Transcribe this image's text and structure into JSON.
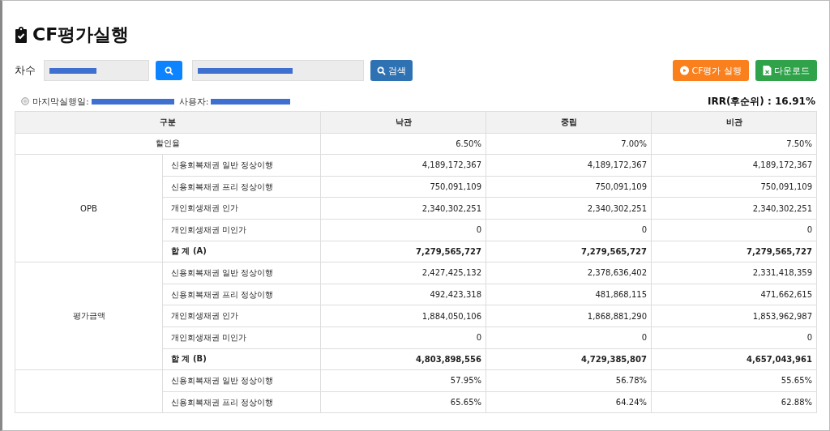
{
  "title": "CF평가실행",
  "filter": {
    "round_label": "차수",
    "search_button": "검색"
  },
  "actions": [
    {
      "kind": "run",
      "label": "CF평가 실행"
    },
    {
      "kind": "download",
      "label": "다운로드"
    }
  ],
  "info": {
    "last_run_label": "마지막실행일:",
    "user_label": "사용자:",
    "irr": "IRR(후순위) : 16.91%"
  },
  "table": {
    "columns": [
      "구분",
      "낙관",
      "중립",
      "비관"
    ],
    "rate_row": {
      "label": "할인율",
      "values": [
        "6.50%",
        "7.00%",
        "7.50%"
      ]
    },
    "groups": [
      {
        "label": "OPB",
        "rows": [
          {
            "kind": "item",
            "label": "신용회복채권 일반 정상이행",
            "values": [
              "4,189,172,367",
              "4,189,172,367",
              "4,189,172,367"
            ]
          },
          {
            "kind": "item",
            "label": "신용회복채권 프리 정상이행",
            "values": [
              "750,091,109",
              "750,091,109",
              "750,091,109"
            ]
          },
          {
            "kind": "item",
            "label": "개인회생채권 인가",
            "values": [
              "2,340,302,251",
              "2,340,302,251",
              "2,340,302,251"
            ]
          },
          {
            "kind": "item",
            "label": "개인회생채권 미인가",
            "values": [
              "0",
              "0",
              "0"
            ]
          },
          {
            "kind": "total",
            "label": "합 계 (A)",
            "values": [
              "7,279,565,727",
              "7,279,565,727",
              "7,279,565,727"
            ]
          }
        ]
      },
      {
        "label": "평가금액",
        "rows": [
          {
            "kind": "item",
            "label": "신용회복채권 일반 정상이행",
            "values": [
              "2,427,425,132",
              "2,378,636,402",
              "2,331,418,359"
            ]
          },
          {
            "kind": "item",
            "label": "신용회복채권 프리 정상이행",
            "values": [
              "492,423,318",
              "481,868,115",
              "471,662,615"
            ]
          },
          {
            "kind": "item",
            "label": "개인회생채권 인가",
            "values": [
              "1,884,050,106",
              "1,868,881,290",
              "1,853,962,987"
            ]
          },
          {
            "kind": "item",
            "label": "개인회생채권 미인가",
            "values": [
              "0",
              "0",
              "0"
            ]
          },
          {
            "kind": "total",
            "label": "합 계 (B)",
            "values": [
              "4,803,898,556",
              "4,729,385,807",
              "4,657,043,961"
            ]
          }
        ]
      },
      {
        "rows": [
          {
            "kind": "item",
            "label": "신용회복채권 일반 정상이행",
            "values": [
              "57.95%",
              "56.78%",
              "55.65%"
            ]
          },
          {
            "kind": "item",
            "label": "신용회복채권 프리 정상이행",
            "values": [
              "65.65%",
              "64.24%",
              "62.88%"
            ]
          }
        ]
      }
    ]
  }
}
